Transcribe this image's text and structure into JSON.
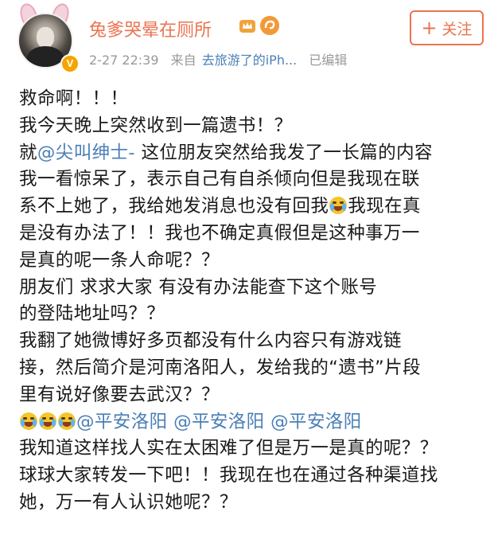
{
  "post": {
    "username": "兔爹哭晕在厕所",
    "timestamp": "2-27 22:39",
    "source_prefix": "来自",
    "source_name": "去旅游了的iPh...",
    "edited": "已编辑",
    "verified_badge": "V",
    "follow_label": "关注",
    "icons": [
      "avatar",
      "verified-badge-icon",
      "crown-icon",
      "swirl-icon",
      "plus-icon",
      "cry-emoji-icon"
    ],
    "colors": {
      "username": "#eb7350",
      "link": "#4a7fb6",
      "meta": "#999999"
    }
  },
  "body": {
    "l1": "救命啊！！！",
    "l2": "我今天晚上突然收到一篇遗书！？",
    "l3_a": "就",
    "l3_mention": "@尖叫绅士-",
    "l3_b": " 这位朋友突然给我发了一长篇的内容",
    "l4": "我一看惊呆了，表示自己有自杀倾向但是我现在联",
    "l5_a": "系不上她了，我给她发消息也没有回我",
    "l5_b": "我现在真",
    "l6": "是没有办法了！！我也不确定真假但是这种事万一",
    "l7": "是真的呢一条人命呢？？",
    "l8": "朋友们 求求大家 有没有办法能查下这个账号",
    "l9": "的登陆地址吗？？",
    "l10": "我翻了她微博好多页都没有什么内容只有游戏链",
    "l11": "接，然后简介是河南洛阳人，发给我的“遗书”片段",
    "l12": "里有说好像要去武汉？？",
    "l13_m1": "@平安洛阳",
    "l13_m2": "@平安洛阳",
    "l13_m3": "@平安洛阳",
    "l14": "我知道这样找人实在太困难了但是万一是真的呢？？",
    "l15": "球球大家转发一下吧！！我现在也在通过各种渠道找",
    "l16": "她，万一有人认识她呢？？"
  }
}
